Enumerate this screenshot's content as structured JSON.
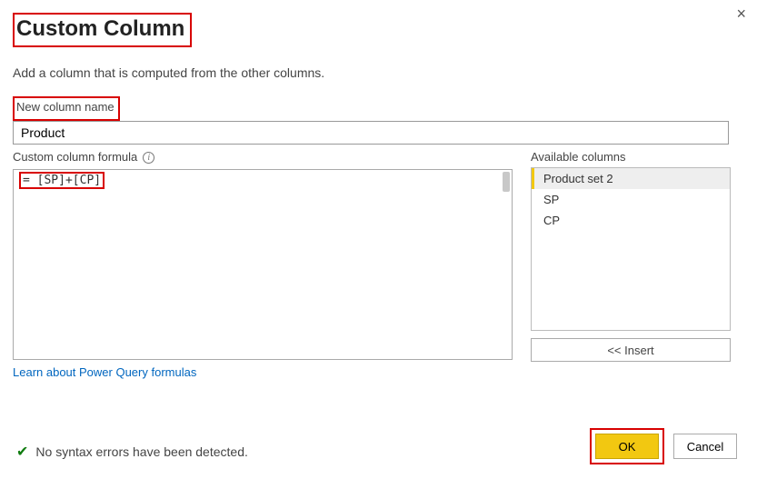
{
  "dialog": {
    "title": "Custom Column",
    "description": "Add a column that is computed from the other columns."
  },
  "nameField": {
    "label": "New column name",
    "value": "Product"
  },
  "formula": {
    "label": "Custom column formula",
    "prefix": "= ",
    "expr": "[SP]+[CP]"
  },
  "available": {
    "label": "Available columns",
    "items": [
      "Product set 2",
      "SP",
      "CP"
    ],
    "insertLabel": "<< Insert"
  },
  "learnLink": "Learn about Power Query formulas",
  "status": "No syntax errors have been detected.",
  "buttons": {
    "ok": "OK",
    "cancel": "Cancel"
  }
}
